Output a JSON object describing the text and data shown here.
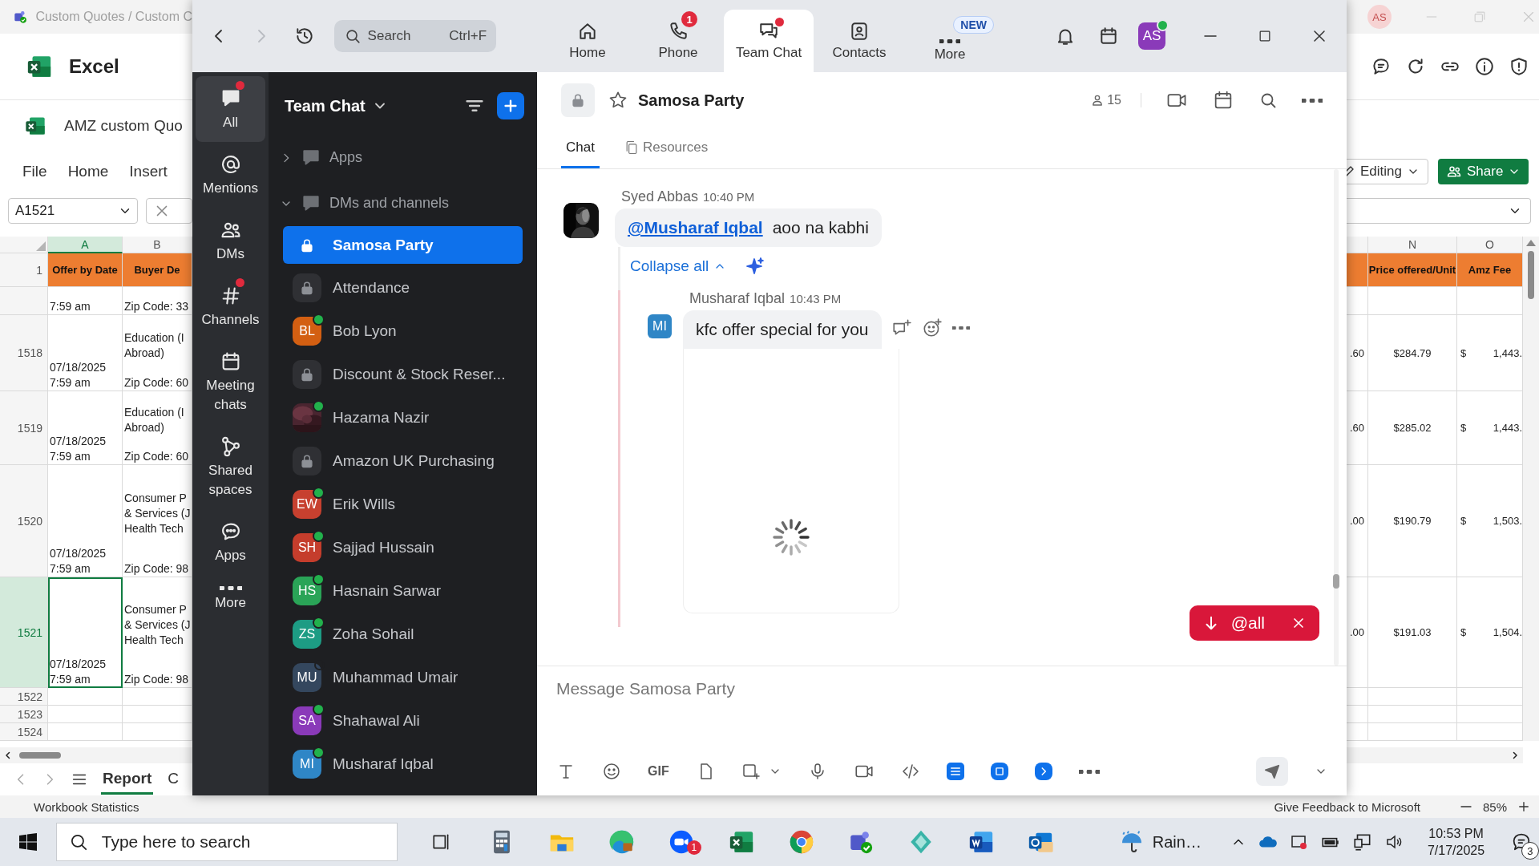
{
  "excel": {
    "title": "Custom Quotes / Custom C",
    "user_initials": "AS",
    "app_name": "Excel",
    "file_name": "AMZ custom Quo",
    "menu": [
      "File",
      "Home",
      "Insert"
    ],
    "editing_label": "Editing",
    "share_label": "Share",
    "name_box": "A1521",
    "columns_left": [
      {
        "label": "A",
        "selected": true
      },
      {
        "label": "B",
        "selected": false
      }
    ],
    "columns_right": [
      {
        "label": "N",
        "selected": false
      },
      {
        "label": "O",
        "selected": false
      }
    ],
    "header_row": {
      "number": "1",
      "cells_left": [
        "Offer by Date",
        "Buyer De"
      ],
      "cells_right": [
        "Price offered/Unit",
        "Amz Fee"
      ]
    },
    "rows": [
      {
        "selected": false,
        "a": [
          "7:59 am"
        ],
        "b_bottom": "Zip Code: 33"
      },
      {
        "number": "1518",
        "selected": false,
        "a": [
          "07/18/2025",
          "7:59 am"
        ],
        "b_top": [
          "Education (I",
          "Abroad)"
        ],
        "b_bottom": "Zip Code: 60",
        "m": ".60",
        "n": "$284.79",
        "o_symbol": "$",
        "o": "1,443."
      },
      {
        "number": "1519",
        "selected": false,
        "a": [
          "07/18/2025",
          "7:59 am"
        ],
        "b_top": [
          "Education (I",
          "Abroad)"
        ],
        "b_bottom": "Zip Code: 60",
        "m": ".60",
        "n": "$285.02",
        "o_symbol": "$",
        "o": "1,443."
      },
      {
        "number": "1520",
        "selected": false,
        "a": [
          "07/18/2025",
          "7:59 am"
        ],
        "b_top": [
          "Consumer P",
          "& Services (J",
          "Health Tech"
        ],
        "b_bottom": "Zip Code: 98",
        "m": ".00",
        "n": "$190.79",
        "o_symbol": "$",
        "o": "1,503."
      },
      {
        "number": "1521",
        "selected": true,
        "a": [
          "07/18/2025",
          "7:59 am"
        ],
        "b_top": [
          "Consumer P",
          "& Services (J",
          "Health Tech"
        ],
        "b_bottom": "Zip Code: 98",
        "m": ".00",
        "n": "$191.03",
        "o_symbol": "$",
        "o": "1,504."
      },
      {
        "number": "1522",
        "selected": false
      },
      {
        "number": "1523",
        "selected": false
      },
      {
        "number": "1524",
        "selected": false
      }
    ],
    "sheet_tabs": [
      {
        "label": "Report",
        "selected": true
      },
      {
        "label": "C",
        "selected": false
      }
    ],
    "status_left": "Workbook Statistics",
    "feedback": "Give Feedback to Microsoft",
    "zoom_level": "85%"
  },
  "zoom": {
    "search": {
      "placeholder": "Search",
      "shortcut": "Ctrl+F"
    },
    "nav": [
      {
        "label": "Home",
        "selected": false,
        "unread": false
      },
      {
        "label": "Phone",
        "selected": false,
        "unread": false,
        "badge": "1"
      },
      {
        "label": "Team Chat",
        "selected": true,
        "unread": true
      },
      {
        "label": "Contacts",
        "selected": false,
        "unread": false
      },
      {
        "label": "More",
        "selected": false,
        "unread": false,
        "tag": "NEW"
      }
    ],
    "user": {
      "initials": "AS",
      "online": true
    },
    "rail": [
      {
        "label": "All",
        "selected": true,
        "unread": true
      },
      {
        "label": "Mentions",
        "selected": false,
        "unread": false
      },
      {
        "label": "DMs",
        "selected": false,
        "unread": false
      },
      {
        "label": "Channels",
        "selected": false,
        "unread": true
      },
      {
        "label": "Meeting chats",
        "selected": false,
        "unread": false
      },
      {
        "label": "Shared spaces",
        "selected": false,
        "unread": false
      },
      {
        "label": "Apps",
        "selected": false,
        "unread": false
      },
      {
        "label": "More",
        "selected": false,
        "unread": false
      }
    ],
    "list_title": "Team Chat",
    "sections": [
      {
        "label": "Apps",
        "expanded": false
      },
      {
        "label": "DMs and channels",
        "expanded": true
      }
    ],
    "chats": [
      {
        "name": "Samosa Party",
        "kind": "channel",
        "selected": true
      },
      {
        "name": "Attendance",
        "kind": "channel",
        "selected": false
      },
      {
        "name": "Bob Lyon",
        "kind": "person",
        "initials": "BL",
        "color": "#d35f12",
        "online": true,
        "selected": false
      },
      {
        "name": "Discount & Stock Reser...",
        "kind": "channel",
        "selected": false
      },
      {
        "name": "Hazama Nazir",
        "online": true,
        "selected": false
      },
      {
        "name": "Amazon UK Purchasing",
        "kind": "channel",
        "selected": false
      },
      {
        "name": "Erik Wills",
        "kind": "person",
        "initials": "EW",
        "color": "#c7402f",
        "online": true,
        "selected": false
      },
      {
        "name": "Sajjad Hussain",
        "kind": "person",
        "initials": "SH",
        "color": "#c53d2c",
        "online": true,
        "selected": false
      },
      {
        "name": "Hasnain Sarwar",
        "kind": "person",
        "initials": "HS",
        "color": "#2aa457",
        "online": true,
        "selected": false
      },
      {
        "name": "Zoha Sohail",
        "kind": "person",
        "initials": "ZS",
        "color": "#1d9c84",
        "online": true,
        "selected": false
      },
      {
        "name": "Muhammad Umair",
        "kind": "person",
        "initials": "MU",
        "color": "#34475e",
        "online": false,
        "selected": false
      },
      {
        "name": "Shahawal Ali",
        "kind": "person",
        "initials": "SA",
        "color": "#8a3ab9",
        "online": true,
        "selected": false
      },
      {
        "name": "Musharaf Iqbal",
        "kind": "person",
        "initials": "MI",
        "color": "#2f86c6",
        "online": true,
        "selected": false
      }
    ],
    "channel": {
      "name": "Samosa Party",
      "member_count": "15",
      "starred": false
    },
    "tabs": [
      {
        "label": "Chat",
        "selected": true
      },
      {
        "label": "Resources",
        "selected": false
      }
    ],
    "message": {
      "author": "Syed Abbas",
      "time": "10:40 PM",
      "mention": "@Musharaf Iqbal",
      "text": "aoo na kabhi"
    },
    "collapse_label": "Collapse all",
    "reply": {
      "author": "Musharaf Iqbal",
      "time": "10:43 PM",
      "initials": "MI",
      "color": "#2f86c6",
      "text": "kfc offer special for you"
    },
    "mention_alert": "@all",
    "composer": {
      "placeholder": "Message Samosa Party",
      "gif_label": "GIF"
    }
  },
  "taskbar": {
    "search_placeholder": "Type here to search",
    "app_badge": "1",
    "weather": "Rain…",
    "time": "10:53 PM",
    "date": "7/17/2025",
    "notifications": "3"
  }
}
